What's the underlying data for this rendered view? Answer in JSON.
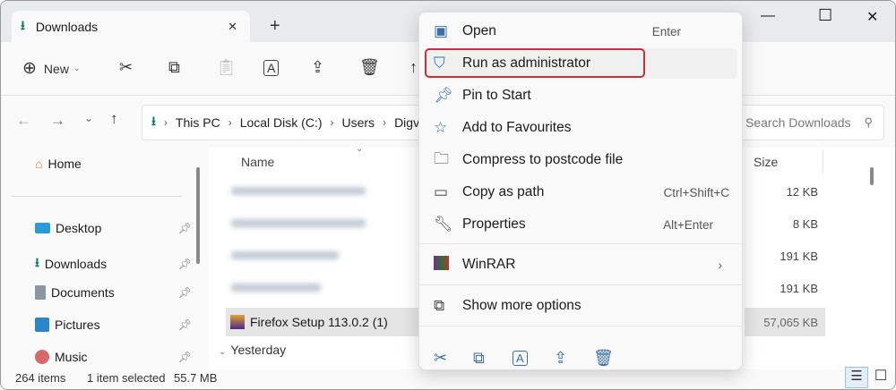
{
  "window": {
    "tab_title": "Downloads",
    "new_tab": "+",
    "min": "—",
    "max": "☐",
    "close": "✕"
  },
  "toolbar": {
    "new_label": "New"
  },
  "address": {
    "crumbs": [
      "This PC",
      "Local Disk (C:)",
      "Users",
      "Digvi"
    ],
    "search_placeholder": "Search Downloads"
  },
  "sidebar": {
    "home": "Home",
    "items": [
      {
        "label": "Desktop"
      },
      {
        "label": "Downloads"
      },
      {
        "label": "Documents"
      },
      {
        "label": "Pictures"
      },
      {
        "label": "Music"
      }
    ]
  },
  "list": {
    "col_name": "Name",
    "col_size": "Size",
    "sizes": [
      "12 KB",
      "8 KB",
      "191 KB",
      "191 KB",
      "57,065 KB"
    ],
    "selected_name": "Firefox Setup 113.0.2 (1)",
    "group_yesterday": "Yesterday"
  },
  "status": {
    "count": "264 items",
    "selected": "1 item selected",
    "size": "55.7 MB"
  },
  "menu": {
    "items": [
      {
        "label": "Open",
        "shortcut": "Enter"
      },
      {
        "label": "Run as administrator",
        "shortcut": ""
      },
      {
        "label": "Pin to Start",
        "shortcut": ""
      },
      {
        "label": "Add to Favourites",
        "shortcut": ""
      },
      {
        "label": "Compress to postcode file",
        "shortcut": ""
      },
      {
        "label": "Copy as path",
        "shortcut": "Ctrl+Shift+C"
      },
      {
        "label": "Properties",
        "shortcut": "Alt+Enter"
      }
    ],
    "winrar": "WinRAR",
    "more": "Show more options"
  },
  "colors": {
    "highlight": "#c8303a",
    "accent": "#0f7b6c",
    "selected_row": "#e5e5e5"
  }
}
